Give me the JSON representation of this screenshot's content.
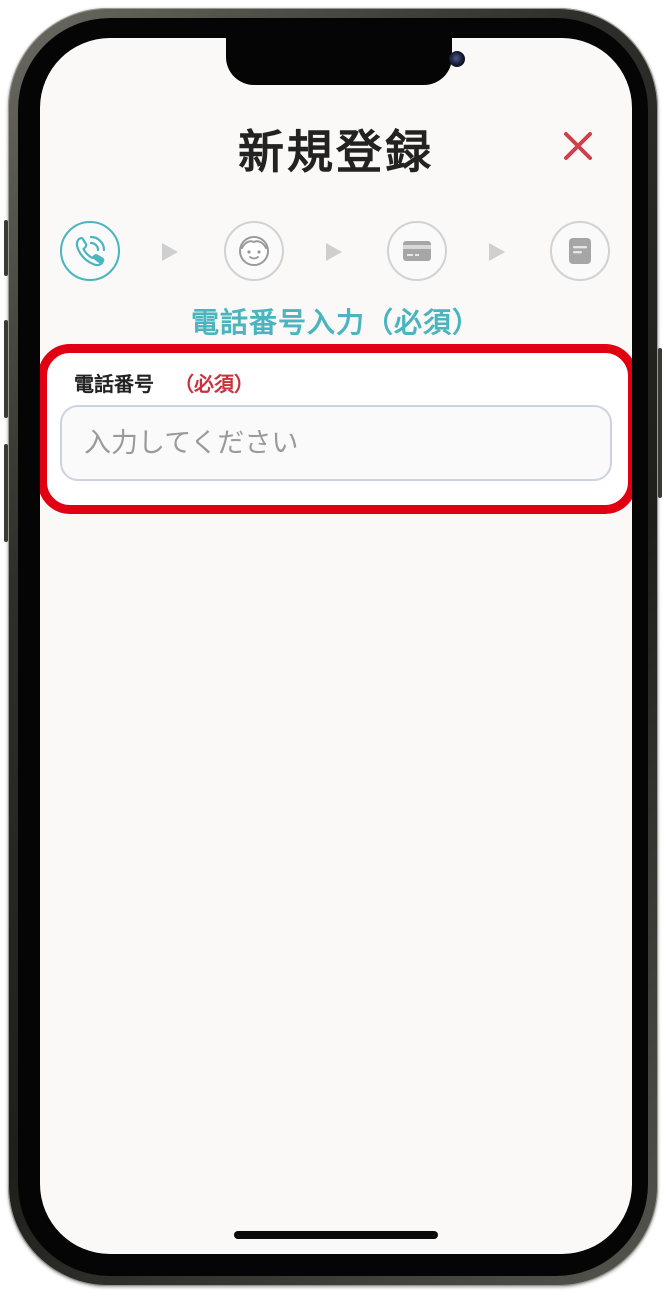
{
  "header": {
    "title": "新規登録",
    "close_icon": "close-icon"
  },
  "steps": [
    {
      "name": "phone",
      "icon": "phone-call-icon",
      "active": true
    },
    {
      "name": "profile",
      "icon": "face-icon",
      "active": false
    },
    {
      "name": "card",
      "icon": "credit-card-icon",
      "active": false
    },
    {
      "name": "document",
      "icon": "document-icon",
      "active": false
    }
  ],
  "step_title": "電話番号入力（必須）",
  "form": {
    "phone_label": "電話番号",
    "required_text": "（必須）",
    "phone_value": "",
    "phone_placeholder": "入力してください"
  },
  "colors": {
    "accent": "#4ab4bf",
    "required": "#c8323c",
    "highlight": "#e00012",
    "close": "#d0404a"
  }
}
